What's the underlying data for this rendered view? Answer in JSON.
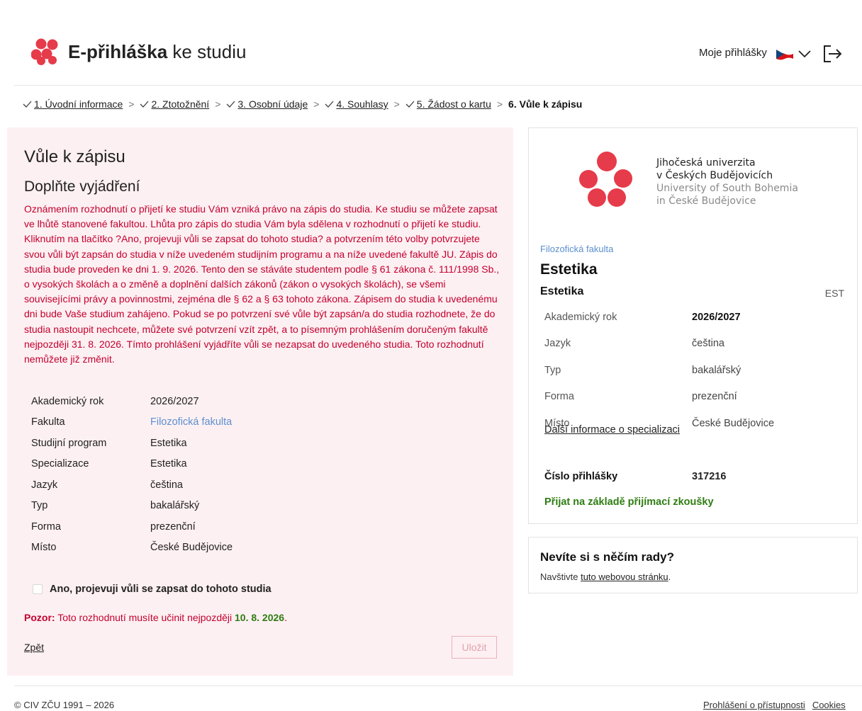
{
  "header": {
    "brand_bold": "E-přihláška",
    "brand_rest": " ke studiu",
    "my_applications": "Moje přihlášky",
    "accent_color": "#e63b4a",
    "language_flag_icon": "czech-flag-icon",
    "logout_icon": "logout-icon"
  },
  "breadcrumb": {
    "steps": [
      {
        "label": "1. Úvodní informace"
      },
      {
        "label": "2. Ztotožnění"
      },
      {
        "label": "3. Osobní údaje"
      },
      {
        "label": "4. Souhlasy"
      },
      {
        "label": "5. Žádost o kartu"
      }
    ],
    "separator": ">",
    "current": "6. Vůle k zápisu"
  },
  "main": {
    "title": "Vůle k zápisu",
    "subtitle": "Doplňte vyjádření",
    "notice": "Oznámením rozhodnutí o přijetí ke studiu Vám vzniká právo na zápis do studia. Ke studiu se můžete zapsat ve lhůtě stanovené fakultou. Lhůta pro zápis do studia Vám byla sdělena v rozhodnutí o přijetí ke studiu. Kliknutím na tlačítko ?Ano, projevuji vůli se zapsat do tohoto studia? a potvrzením této volby potvrzujete svou vůli být zapsán do studia v níže uvedeném studijním programu a na níže uvedené fakultě JU. Zápis do studia bude proveden ke dni 1. 9. 2026. Tento den se stáváte studentem podle § 61 zákona č. 111/1998 Sb., o vysokých školách a o změně a doplnění dalších zákonů (zákon o vysokých školách), se všemi souvisejícími právy a povinnostmi, zejména dle § 62 a § 63 tohoto zákona. Zápisem do studia k uvedenému dni bude Vaše studium zahájeno. Pokud se po potvrzení své vůle být zapsán/a do studia rozhodnete, že do studia nastoupit nechcete, můžete své potvrzení vzít zpět, a to písemným prohlášením doručeným fakultě nejpozději 31. 8. 2026. Tímto prohlášení vyjádříte vůli se nezapsat do uvedeného studia. Toto rozhodnutí nemůžete již změnit.",
    "details": [
      {
        "key": "Akademický rok",
        "value": "2026/2027"
      },
      {
        "key": "Fakulta",
        "value": "Filozofická fakulta"
      },
      {
        "key": "Studijní program",
        "value": "Estetika"
      },
      {
        "key": "Specializace",
        "value": "Estetika"
      },
      {
        "key": "Jazyk",
        "value": "čeština"
      },
      {
        "key": "Typ",
        "value": "bakalářský"
      },
      {
        "key": "Forma",
        "value": "prezenční"
      },
      {
        "key": "Místo",
        "value": "České Budějovice"
      }
    ],
    "agree_label": "Ano, projevuji vůli se zapsat do tohoto studia",
    "agree_checked": false,
    "warning_prefix": "Pozor:",
    "warning_text": " Toto rozhodnutí musíte učinit nejpozději ",
    "warning_deadline": "10. 8. 2026",
    "warning_end": ".",
    "back_label": "Zpět",
    "save_label": "Uložit"
  },
  "summary": {
    "university_cz_1": "Jihočeská univerzita",
    "university_cz_2": "v Českých Budějovicích",
    "university_en_1": "University of South Bohemia",
    "university_en_2": "in České Budějovice",
    "faculty": "Filozofická fakulta",
    "program": "Estetika",
    "specialization": "Estetika",
    "specialization_code": "EST",
    "rows": [
      {
        "key": "Akademický rok",
        "value": "2026/2027"
      },
      {
        "key": "Jazyk",
        "value": "čeština"
      },
      {
        "key": "Typ",
        "value": "bakalářský"
      },
      {
        "key": "Forma",
        "value": "prezenční"
      },
      {
        "key": "Místo",
        "value": "České Budějovice"
      }
    ],
    "more_info": "Další informace o specializaci",
    "application_number_label": "Číslo přihlášky",
    "application_number": "317216",
    "status": "Přijat na základě přijímací zkoušky"
  },
  "help": {
    "title": "Nevíte si s něčím rady?",
    "text_before": "Navštivte ",
    "link": "tuto webovou stránku",
    "text_after": "."
  },
  "footer": {
    "copyright": "© CIV ZČU 1991 – 2026",
    "links": [
      "Prohlášení o přístupnosti",
      "Cookies"
    ]
  }
}
